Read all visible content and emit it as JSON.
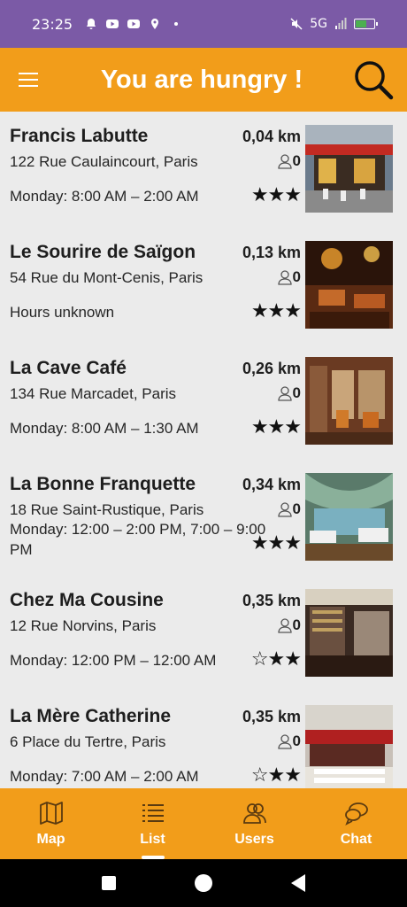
{
  "status_bar": {
    "time": "23:25",
    "left_icons": [
      "bell-icon",
      "youtube-icon",
      "youtube-icon",
      "location-icon",
      "dot-icon"
    ],
    "network": "5G",
    "right_icons": [
      "mute-icon",
      "signal-icon",
      "battery-charging-icon"
    ]
  },
  "app_bar": {
    "title": "You are hungry !",
    "menu_icon": "hamburger-menu-icon",
    "search_icon": "search-icon",
    "color": "#f29d1a"
  },
  "restaurants": [
    {
      "name": "Francis Labutte",
      "distance": "0,04 km",
      "address": "122 Rue Caulaincourt, Paris",
      "users": "0",
      "hours": "Monday: 8:00 AM – 2:00 AM",
      "stars": "★★★",
      "photo": "restaurant-terrace-photo"
    },
    {
      "name": "Le Sourire de Saïgon",
      "distance": "0,13 km",
      "address": "54 Rue du Mont-Cenis, Paris",
      "users": "0",
      "hours": "Hours unknown",
      "stars": "★★★",
      "photo": "restaurant-interior-photo"
    },
    {
      "name": "La Cave Café",
      "distance": "0,26 km",
      "address": "134 Rue Marcadet, Paris",
      "users": "0",
      "hours": "Monday: 8:00 AM – 1:30 AM",
      "stars": "★★★",
      "photo": "cafe-storefront-photo"
    },
    {
      "name": "La Bonne Franquette",
      "distance": "0,34 km",
      "address": "18 Rue Saint-Rustique, Paris",
      "users": "0",
      "hours": "Monday: 12:00 – 2:00 PM, 7:00 – 9:00 PM",
      "stars": "★★★",
      "photo": "dining-room-photo"
    },
    {
      "name": "Chez Ma Cousine",
      "distance": "0,35 km",
      "address": "12 Rue Norvins, Paris",
      "users": "0",
      "hours": "Monday: 12:00 PM – 12:00 AM",
      "stars": "☆★★",
      "photo": "bar-interior-photo"
    },
    {
      "name": "La Mère Catherine",
      "distance": "0,35 km",
      "address": "6 Place du Tertre, Paris",
      "users": "0",
      "hours": "Monday: 7:00 AM – 2:00 AM",
      "stars": "☆★★",
      "photo": "red-awning-terrace-photo"
    }
  ],
  "bottom_nav": {
    "items": [
      {
        "label": "Map",
        "icon": "map-icon"
      },
      {
        "label": "List",
        "icon": "list-icon",
        "active": true
      },
      {
        "label": "Users",
        "icon": "users-icon"
      },
      {
        "label": "Chat",
        "icon": "chat-icon"
      }
    ]
  },
  "system_nav": [
    "recents-square-icon",
    "home-circle-icon",
    "back-triangle-icon"
  ]
}
